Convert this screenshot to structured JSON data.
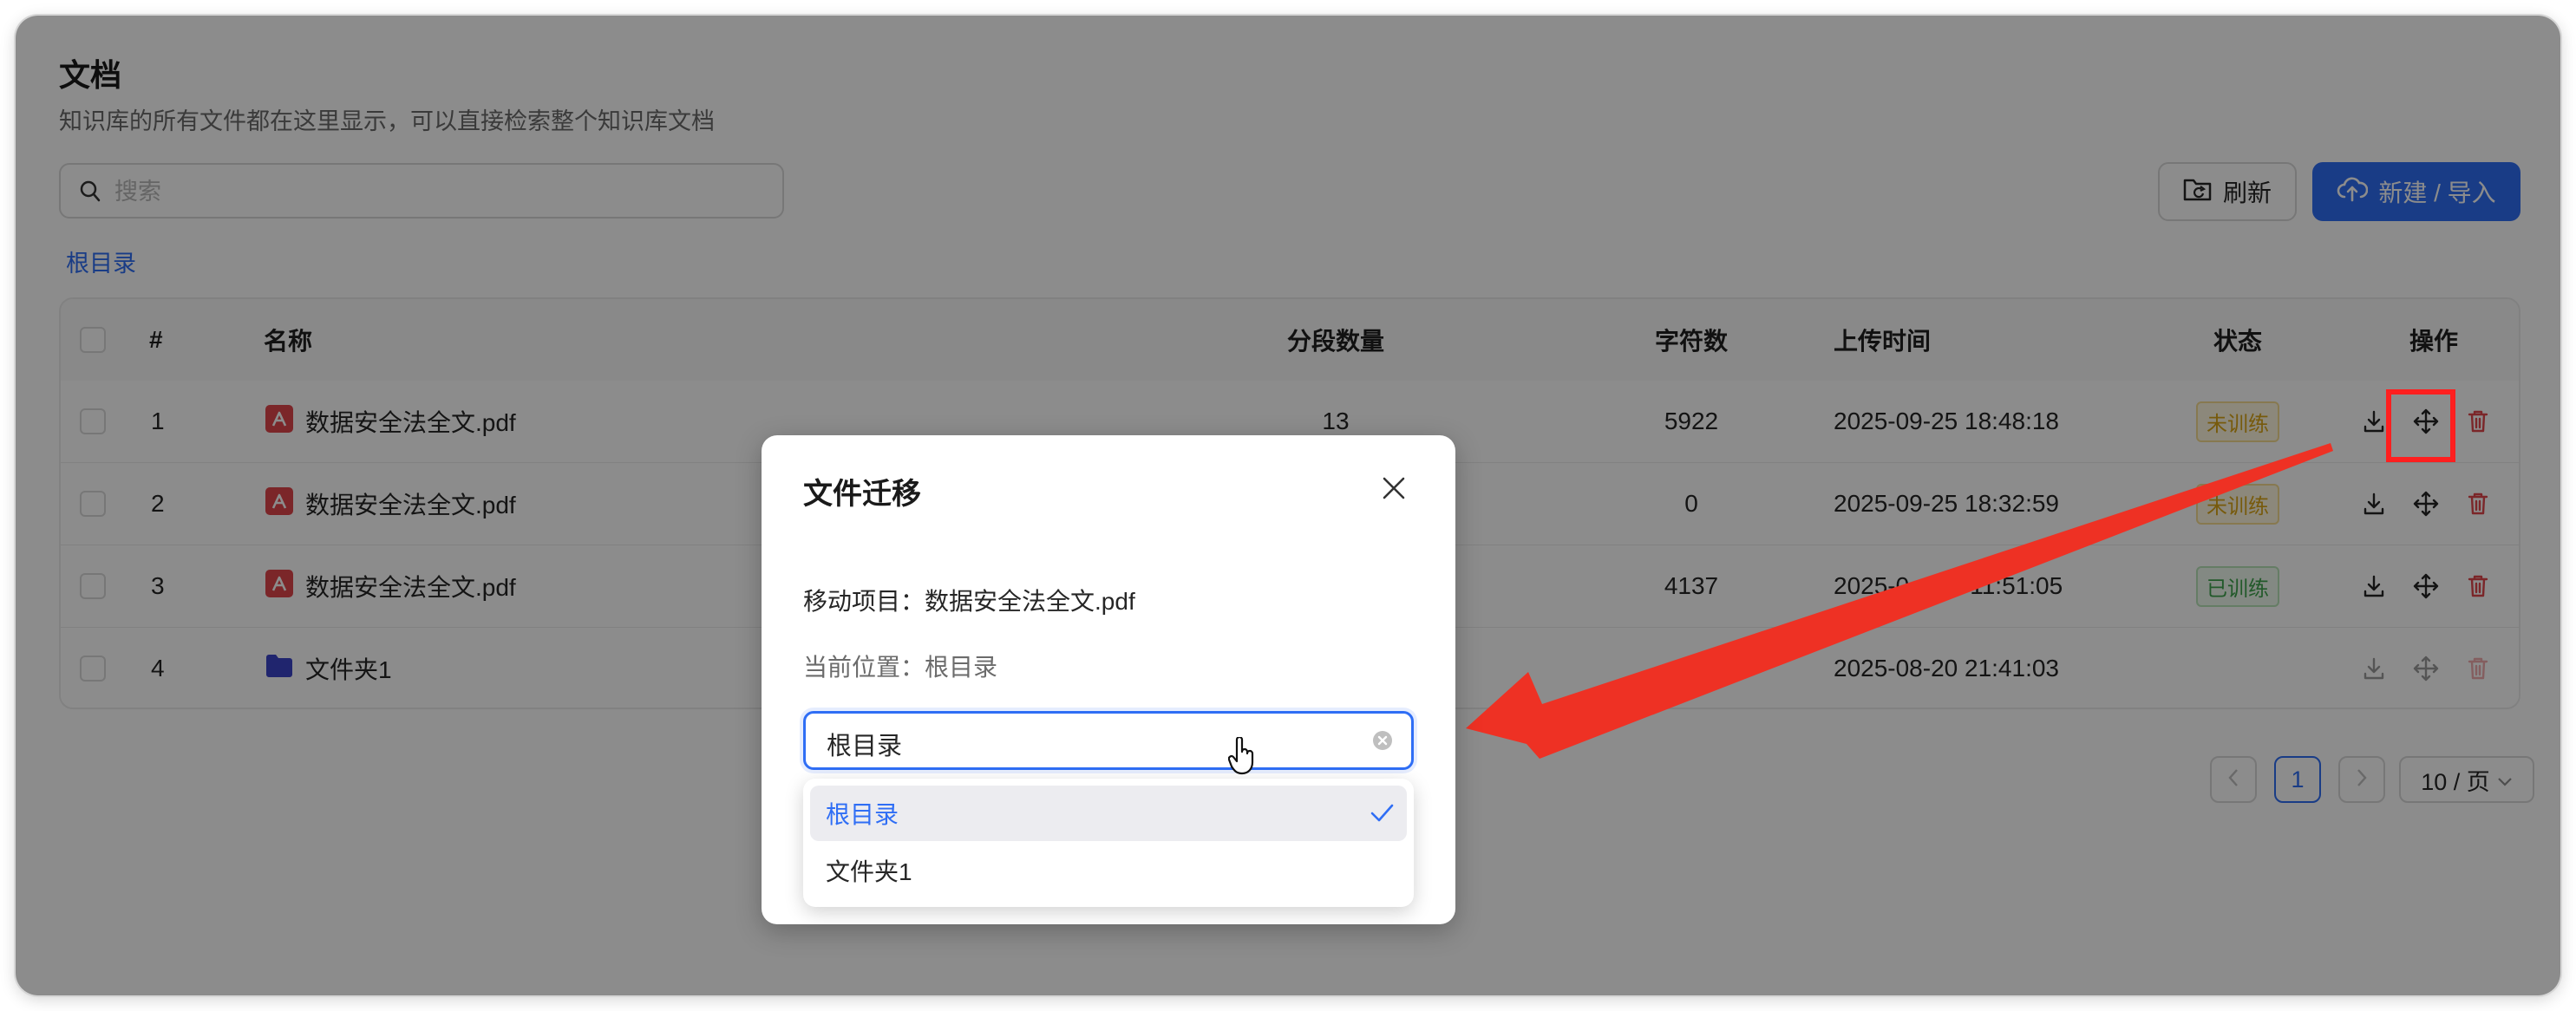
{
  "page": {
    "title": "文档",
    "description": "知识库的所有文件都在这里显示，可以直接检索整个知识库文档"
  },
  "search": {
    "placeholder": "搜索"
  },
  "toolbar": {
    "refresh_label": "刷新",
    "new_label": "新建 / 导入"
  },
  "breadcrumb": {
    "root": "根目录"
  },
  "table": {
    "headers": {
      "index": "#",
      "name": "名称",
      "segments": "分段数量",
      "chars": "字符数",
      "upload_time": "上传时间",
      "status": "状态",
      "actions": "操作"
    },
    "rows": [
      {
        "index": "1",
        "name": "数据安全法全文.pdf",
        "type": "pdf",
        "segments": "13",
        "chars": "5922",
        "upload_time": "2025-09-25 18:48:18",
        "status": "未训练"
      },
      {
        "index": "2",
        "name": "数据安全法全文.pdf",
        "type": "pdf",
        "segments": "",
        "chars": "0",
        "upload_time": "2025-09-25 18:32:59",
        "status": "未训练"
      },
      {
        "index": "3",
        "name": "数据安全法全文.pdf",
        "type": "pdf",
        "segments": "",
        "chars": "4137",
        "upload_time": "2025-0    21 11:51:05",
        "status": "已训练"
      },
      {
        "index": "4",
        "name": "文件夹1",
        "type": "folder",
        "segments": "",
        "chars": "",
        "upload_time": "2025-08-20 21:41:03",
        "status": ""
      }
    ]
  },
  "pagination": {
    "current_page": "1",
    "page_size_label": "10 / 页"
  },
  "modal": {
    "title": "文件迁移",
    "item_label": "移动项目：",
    "item_value": "数据安全法全文.pdf",
    "location_label": "当前位置：",
    "location_value": "根目录",
    "select_value": "根目录",
    "options": [
      "根目录",
      "文件夹1"
    ],
    "selected_option": "根目录"
  },
  "colors": {
    "primary": "#2f6ef5",
    "danger": "#e0464b",
    "untrained": "#d9a516",
    "trained": "#3fa34d",
    "annotation": "#ff1f1f"
  },
  "icons": [
    "search-icon",
    "folder-refresh-icon",
    "cloud-upload-icon",
    "pdf-icon",
    "folder-icon",
    "download-icon",
    "move-icon",
    "trash-icon",
    "close-icon",
    "clear-icon",
    "check-icon",
    "hand-cursor-icon",
    "chevron-left-icon",
    "chevron-right-icon",
    "chevron-down-icon"
  ]
}
